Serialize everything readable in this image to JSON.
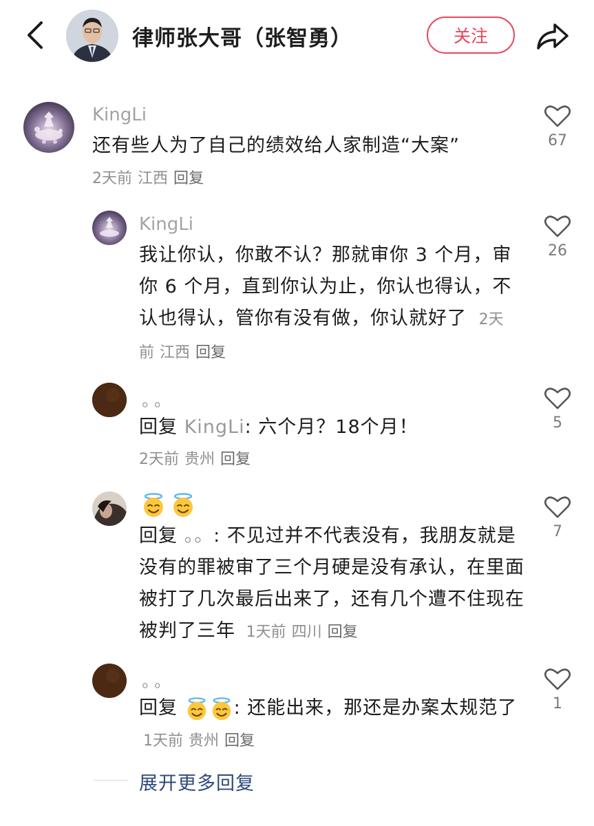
{
  "header": {
    "title": "律师张大哥（张智勇）",
    "follow_label": "关注",
    "back_icon": "chevron-left-icon",
    "share_icon": "share-arrow-icon"
  },
  "comments": [
    {
      "username": "KingLi",
      "text": "还有些人为了自己的绩效给人家制造“大案”",
      "time": "2天前",
      "location": "江西",
      "reply": "回复",
      "likes": "67"
    },
    {
      "username": "KingLi",
      "text": "我让你认，你敢不认？那就审你 3 个月，审你 6 个月，直到你认为止，你认也得认，不认也得认，管你有没有做，你认就好了",
      "time": "2天前",
      "location": "江西",
      "reply": "回复",
      "likes": "26"
    },
    {
      "username": "。。",
      "reply_prefix": "回复",
      "reply_to": "KingLi",
      "text": ": 六个月？18个月！",
      "time": "2天前",
      "location": "贵州",
      "reply": "回复",
      "likes": "5"
    },
    {
      "username_emoji": "halo-smile-emoji",
      "reply_prefix": "回复",
      "reply_to": "。。",
      "text": ": 不见过并不代表没有，我朋友就是没有的罪被审了三个月硬是没有承认，在里面被打了几次最后出来了，还有几个遭不住现在被判了三年",
      "time": "1天前",
      "location": "四川",
      "reply": "回复",
      "likes": "7"
    },
    {
      "username": "。。",
      "reply_prefix": "回复",
      "reply_to_emoji": "halo-smile-emoji",
      "text": ": 还能出来，那还是办案太规范了",
      "time": "1天前",
      "location": "贵州",
      "reply": "回复",
      "likes": "1"
    }
  ],
  "expand_more": "展开更多回复",
  "colors": {
    "accent": "#e8455a",
    "link": "#2c4a7a",
    "secondary_text": "#8e8e8e"
  }
}
